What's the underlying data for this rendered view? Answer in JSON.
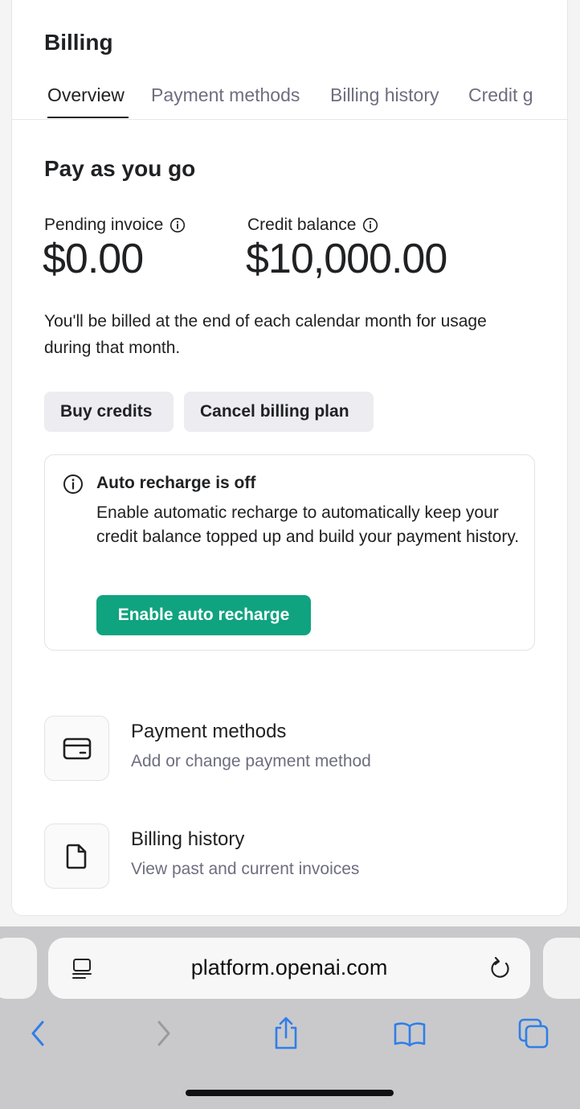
{
  "page": {
    "title": "Billing",
    "tabs": [
      {
        "label": "Overview",
        "active": true
      },
      {
        "label": "Payment methods",
        "active": false
      },
      {
        "label": "Billing history",
        "active": false
      },
      {
        "label": "Credit g",
        "active": false
      }
    ]
  },
  "plan": {
    "title": "Pay as you go",
    "pending_invoice_label": "Pending invoice",
    "pending_invoice_value": "$0.00",
    "credit_balance_label": "Credit balance",
    "credit_balance_value": "$10,000.00",
    "description": "You'll be billed at the end of each calendar month for usage during that month.",
    "buy_credits_label": "Buy credits",
    "cancel_plan_label": "Cancel billing plan"
  },
  "auto_recharge": {
    "title": "Auto recharge is off",
    "text": "Enable automatic recharge to automatically keep your credit balance topped up and build your payment history.",
    "button_label": "Enable auto recharge"
  },
  "links": [
    {
      "title": "Payment methods",
      "subtitle": "Add or change payment method",
      "icon": "credit-card-icon"
    },
    {
      "title": "Billing history",
      "subtitle": "View past and current invoices",
      "icon": "document-icon"
    }
  ],
  "browser": {
    "url": "platform.openai.com",
    "icons": [
      "reader-icon",
      "reload-icon",
      "back-icon",
      "forward-icon",
      "share-icon",
      "bookmarks-icon",
      "tabs-icon"
    ]
  },
  "colors": {
    "accent_green": "#10a37f",
    "ios_blue": "#2f7fe6",
    "button_gray": "#ececf1",
    "muted_text": "#6e6e80"
  }
}
